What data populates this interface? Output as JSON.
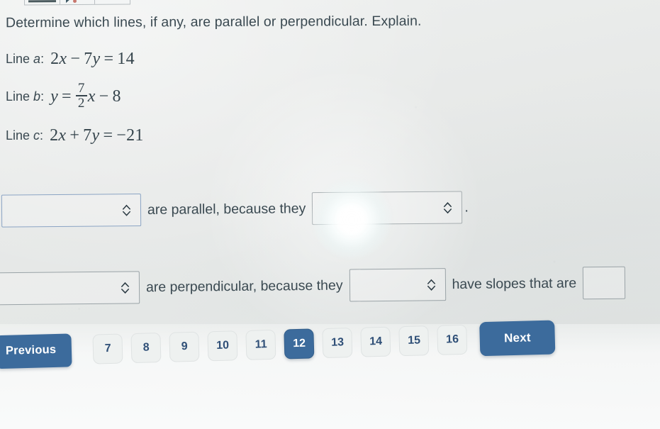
{
  "toolbar": {
    "cells": [
      "menu-icon",
      "cursor-icon",
      "blank-icon"
    ]
  },
  "question": {
    "prompt": "Determine which lines, if any, are parallel or perpendicular. Explain.",
    "lines": [
      {
        "label_prefix": "Line",
        "label_letter": "a",
        "label_colon": ":",
        "equation_text": "2x - 7y = 14",
        "parts": {
          "lhs_coef": "2",
          "lhs_var": "x",
          "op1": "−",
          "term2_coef": "7",
          "term2_var": "y",
          "eq": "=",
          "rhs": "14"
        }
      },
      {
        "label_prefix": "Line",
        "label_letter": "b",
        "label_colon": ":",
        "equation_text": "y = 7/2 x - 8",
        "parts": {
          "lhs_var": "y",
          "eq": "=",
          "frac_num": "7",
          "frac_den": "2",
          "frac_var": "x",
          "op1": "−",
          "rhs": "8"
        }
      },
      {
        "label_prefix": "Line",
        "label_letter": "c",
        "label_colon": ":",
        "equation_text": "2x + 7y = -21",
        "parts": {
          "lhs_coef": "2",
          "lhs_var": "x",
          "op1": "+",
          "term2_coef": "7",
          "term2_var": "y",
          "eq": "=",
          "rhs": "−21"
        }
      }
    ]
  },
  "answers": {
    "row1": {
      "dropdown_lines_value": "",
      "text_are_parallel": "are parallel, because they",
      "dropdown_reason_value": "",
      "period": "."
    },
    "row2": {
      "dropdown_lines_value": "",
      "text_are_perpendicular": "are perpendicular, because they",
      "dropdown_reason_value": "",
      "text_have_slopes": "have slopes that are",
      "dropdown_slopes_value": ""
    }
  },
  "nav": {
    "previous_label": "Previous",
    "next_label": "Next",
    "pages": [
      "7",
      "8",
      "9",
      "10",
      "11",
      "12",
      "13",
      "14",
      "15",
      "16"
    ],
    "active_page": "12"
  },
  "colors": {
    "accent_blue": "#3c6b9c",
    "page_text_blue": "#2f4f77",
    "text": "#3a4951",
    "dropdown_border_active": "#8ba4c4",
    "dropdown_border_neutral": "#9aa3a7",
    "background": "#e9ebea"
  }
}
